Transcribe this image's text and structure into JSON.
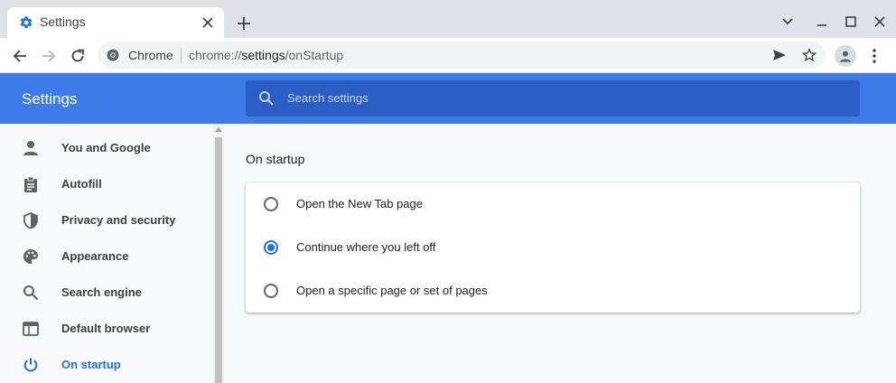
{
  "tab": {
    "title": "Settings",
    "close_icon": "close-icon"
  },
  "omnibox": {
    "site_label": "Chrome",
    "url_scheme": "chrome://",
    "url_host": "settings",
    "url_path": "/onStartup"
  },
  "header": {
    "title": "Settings",
    "search_placeholder": "Search settings"
  },
  "sidebar": {
    "items": [
      {
        "label": "You and Google",
        "icon": "person-icon"
      },
      {
        "label": "Autofill",
        "icon": "clipboard-icon"
      },
      {
        "label": "Privacy and security",
        "icon": "shield-icon"
      },
      {
        "label": "Appearance",
        "icon": "palette-icon"
      },
      {
        "label": "Search engine",
        "icon": "search-icon"
      },
      {
        "label": "Default browser",
        "icon": "browser-window-icon"
      },
      {
        "label": "On startup",
        "icon": "power-icon",
        "active": true
      }
    ]
  },
  "main": {
    "section_title": "On startup",
    "options": [
      {
        "label": "Open the New Tab page",
        "checked": false
      },
      {
        "label": "Continue where you left off",
        "checked": true
      },
      {
        "label": "Open a specific page or set of pages",
        "checked": false
      }
    ]
  },
  "colors": {
    "accent": "#1a73e8",
    "header_bg": "#3c7be8",
    "search_bg": "#2b5ec4"
  }
}
